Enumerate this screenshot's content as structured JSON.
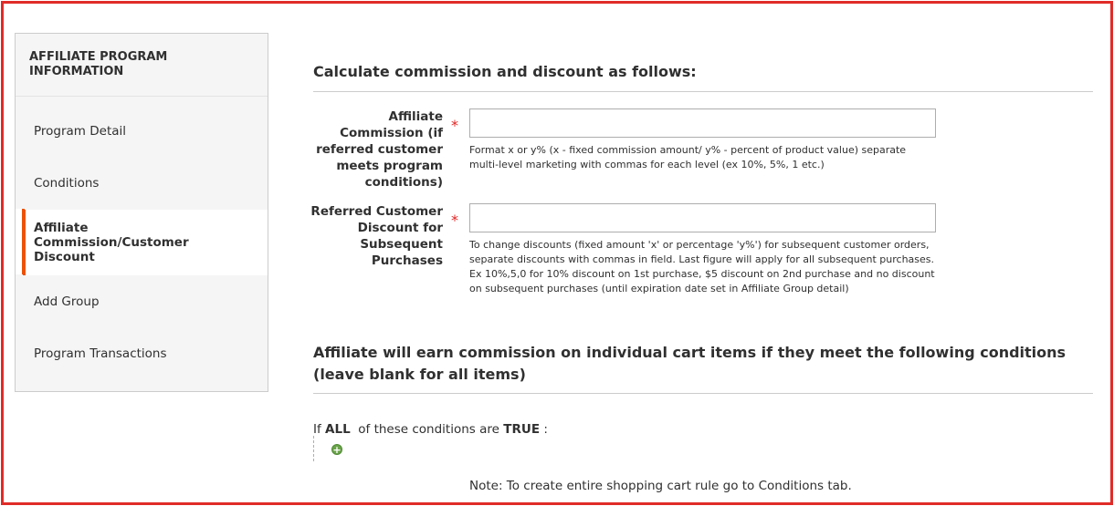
{
  "sidebar": {
    "title": "AFFILIATE PROGRAM INFORMATION",
    "items": [
      {
        "label": "Program Detail"
      },
      {
        "label": "Conditions"
      },
      {
        "label": "Affiliate Commission/Customer Discount"
      },
      {
        "label": "Add Group"
      },
      {
        "label": "Program Transactions"
      }
    ],
    "active_index": 2
  },
  "main": {
    "section1_title": "Calculate commission and discount as follows:",
    "commission": {
      "label": "Affiliate Commission (if referred customer meets program conditions)",
      "value": "",
      "required": "*",
      "note": "Format x or y% (x - fixed commission amount/ y% - percent of product value) separate multi-level marketing with commas for each level (ex 10%, 5%, 1 etc.)"
    },
    "discount": {
      "label": "Referred Customer Discount for Subsequent Purchases",
      "value": "",
      "required": "*",
      "note": "To change discounts (fixed amount 'x' or percentage 'y%') for subsequent customer orders, separate discounts with commas in field. Last figure will apply for all subsequent purchases. Ex 10%,5,0 for 10% discount on 1st purchase, $5 discount on 2nd purchase and no discount on subsequent purchases (until expiration date set in Affiliate Group detail)"
    },
    "section2_title": "Affiliate will earn commission on individual cart items if they meet the following conditions (leave blank for all items)",
    "conditions": {
      "prefix": "If",
      "aggregator": "ALL",
      "middle": "of these conditions are",
      "value": "TRUE",
      "suffix": ":"
    },
    "bottom_note": "Note: To create entire shopping cart rule go to Conditions tab."
  },
  "colors": {
    "frame": "#e02b27",
    "active_accent": "#eb5202",
    "required": "#e22626",
    "add_icon": "#6ba44a"
  }
}
